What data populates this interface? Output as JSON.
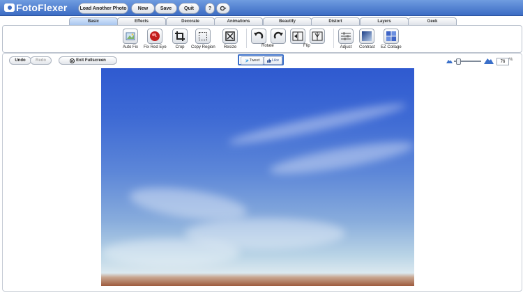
{
  "app": {
    "logo_text": "FotoFlexer"
  },
  "topbar": {
    "load_label": "Load Another Photo",
    "new_label": "New",
    "save_label": "Save",
    "quit_label": "Quit",
    "help_label": "?",
    "settings_icon": "gear-icon"
  },
  "tabs": [
    {
      "label": "Basic",
      "active": true
    },
    {
      "label": "Effects"
    },
    {
      "label": "Decorate"
    },
    {
      "label": "Animations"
    },
    {
      "label": "Beautify"
    },
    {
      "label": "Distort"
    },
    {
      "label": "Layers"
    },
    {
      "label": "Geek"
    }
  ],
  "tools": {
    "auto_fix": "Auto Fix",
    "fix_red_eye": "Fix Red Eye",
    "crop": "Crop",
    "copy_region": "Copy Region",
    "resize": "Resize",
    "rotate": "Rotate",
    "flip": "Flip",
    "adjust": "Adjust",
    "contrast": "Contrast",
    "ez_collage": "EZ Collage"
  },
  "workspace": {
    "undo_label": "Undo",
    "redo_label": "Redo",
    "exit_fullscreen_label": "Exit Fullscreen",
    "tweet_label": "Tweet",
    "like_label": "Like",
    "zoom_value": "76",
    "zoom_unit": "%",
    "zoom_level": 0.1
  },
  "colors": {
    "brand": "#3c6cc4",
    "highlight": "#3a6fc9"
  }
}
